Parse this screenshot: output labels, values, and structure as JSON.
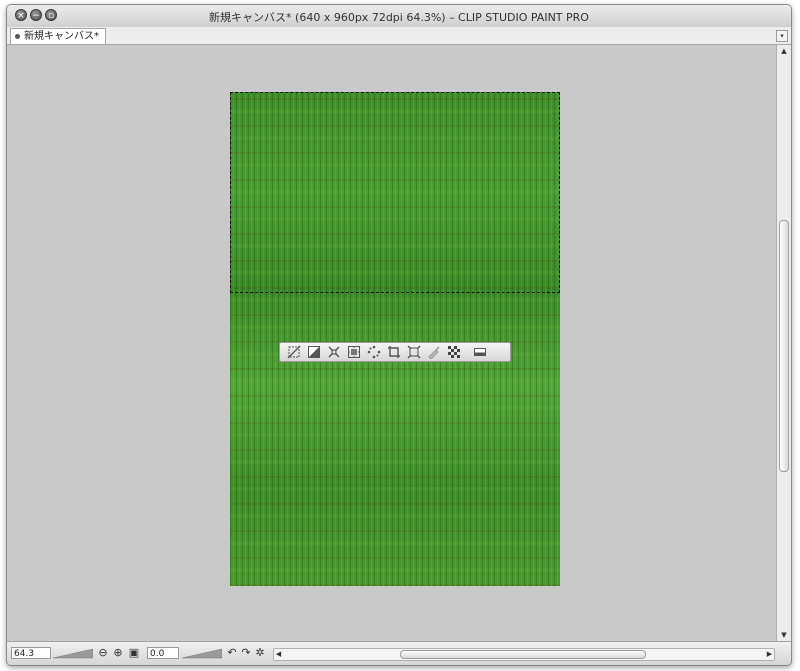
{
  "window": {
    "title": "新規キャンバス* (640 x 960px 72dpi 64.3%)  – CLIP STUDIO PAINT PRO",
    "controls": [
      "close-icon",
      "minimize-icon",
      "maximize-icon"
    ]
  },
  "tabs": [
    {
      "label": "新規キャンバス*"
    }
  ],
  "selection_toolbar": {
    "icons": [
      "deselect-icon",
      "invert-selection-icon",
      "shrink-selection-icon",
      "expand-selection-icon",
      "expand-border-icon",
      "crop-icon",
      "transform-icon",
      "fill-icon",
      "tone-icon",
      "settings-icon"
    ]
  },
  "status_bar": {
    "zoom_value": "64.3",
    "angle_value": "0.0",
    "icons": [
      "zoom-out-icon",
      "zoom-in-icon",
      "fit-icon",
      "rotate-left-icon",
      "rotate-right-icon",
      "reset-rotation-icon"
    ]
  },
  "colors": {
    "workarea_bg": "#c9c9c9",
    "grass_dark": "#3a8a26",
    "grass_light": "#52a636"
  }
}
